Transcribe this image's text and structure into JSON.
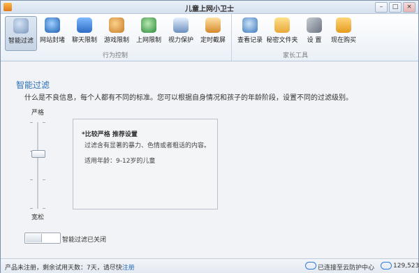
{
  "window": {
    "title": "儿童上网小卫士",
    "minimize": "–",
    "maximize": "□",
    "close": "×"
  },
  "toolbar": {
    "group1_label": "行为控制",
    "group2_label": "家长工具",
    "buttons": [
      {
        "label": "智能过滤",
        "icon": "filter-icon"
      },
      {
        "label": "网站封堵",
        "icon": "compass-icon"
      },
      {
        "label": "聊天限制",
        "icon": "chat-icon"
      },
      {
        "label": "游戏限制",
        "icon": "game-icon"
      },
      {
        "label": "上网限制",
        "icon": "globe-icon"
      },
      {
        "label": "视力保护",
        "icon": "monitor-icon"
      },
      {
        "label": "定时截屏",
        "icon": "camera-icon"
      },
      {
        "label": "查看记录",
        "icon": "magnifier-icon"
      },
      {
        "label": "秘密文件夹",
        "icon": "folder-icon"
      },
      {
        "label": "设 置",
        "icon": "tools-icon"
      },
      {
        "label": "现在购买",
        "icon": "cart-icon"
      }
    ]
  },
  "main": {
    "title": "智能过滤",
    "description": "什么是不良信息，每个人都有不同的标准。您可以根据自身情况和孩子的年龄阶段，设置不同的过滤级别。",
    "strict_label": "严格",
    "loose_label": "宽松",
    "slider_level_from_top": 0.35,
    "info": {
      "title": "*比较严格 推荐设置",
      "desc": "过滤含有显著的暴力、色情或者粗话的内容。",
      "age": "适用年龄：9-12岁的儿童"
    },
    "toggle_label": "智能过滤已关闭"
  },
  "status": {
    "text": "产品未注册，剩余试用天数：7天，请尽快",
    "register": "注册",
    "cloud_status": "已连接至云防护中心",
    "cloud_count": "129,523"
  },
  "colors": {
    "accent": "#2b6fb6"
  }
}
